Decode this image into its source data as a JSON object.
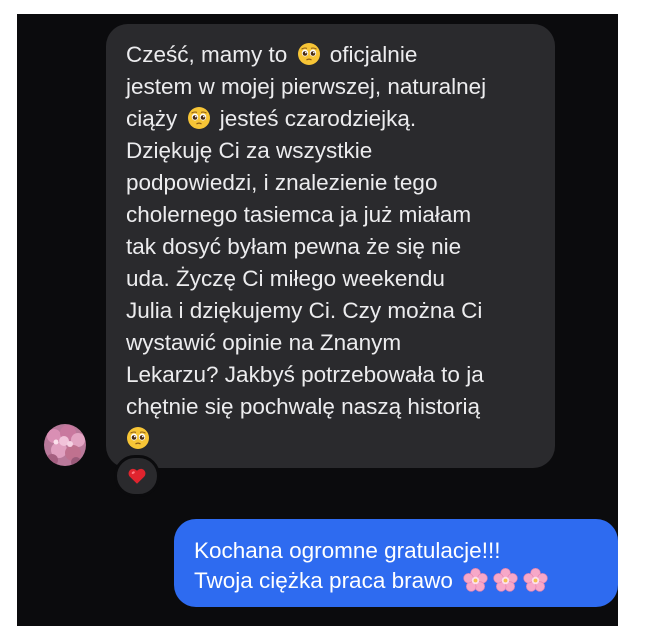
{
  "conversation": {
    "incoming": {
      "lines": [
        {
          "before": "Cześć, mamy to ",
          "emoji": "pleading-face",
          "after": " oficjalnie"
        },
        {
          "text": "jestem w mojej pierwszej, naturalnej"
        },
        {
          "before": "ciąży ",
          "emoji": "pleading-face",
          "after": " jesteś czarodziejką."
        },
        {
          "text": "Dziękuję Ci za wszystkie"
        },
        {
          "text": "podpowiedzi, i znalezienie tego"
        },
        {
          "text": "cholernego tasiemca ja już miałam"
        },
        {
          "text": "tak dosyć byłam pewna że się nie"
        },
        {
          "text": "uda. Życzę Ci miłego weekendu"
        },
        {
          "text": "Julia i dziękujemy Ci. Czy można Ci"
        },
        {
          "text": "wystawić opinie na Znanym"
        },
        {
          "text": "Lekarzu? Jakbyś potrzebowała to ja"
        },
        {
          "text": "chętnie się pochwalę naszą historią"
        }
      ],
      "trailing_emoji": "pleading-face",
      "bubble_color": "#2a2a2d",
      "text_color": "#ececee",
      "avatar": "flowers-avatar",
      "reaction": "red-heart-icon"
    },
    "outgoing": {
      "lines": [
        "Kochana ogromne gratulacje!!!",
        "Twoja ciężka praca brawo"
      ],
      "emojis": [
        "cherry-blossom",
        "cherry-blossom",
        "cherry-blossom"
      ],
      "bubble_color": "#2e6bf0",
      "text_color": "#ffffff"
    },
    "background_color": "#0b0b0d"
  }
}
